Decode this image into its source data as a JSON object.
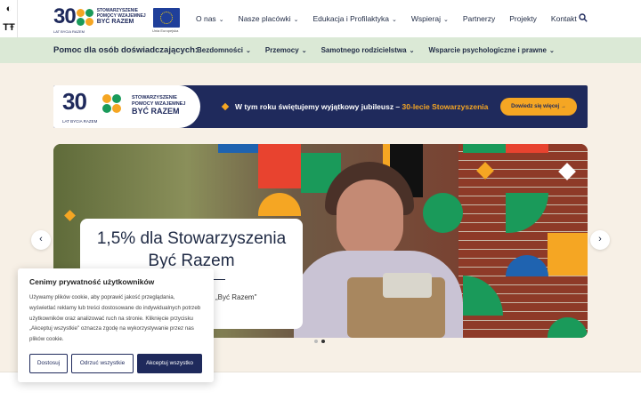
{
  "accessibility": {
    "contrast_icon": "contrast-icon",
    "text_size_label": "TŦ"
  },
  "logo": {
    "number": "30",
    "line1": "STOWARZYSZENIE",
    "line2": "POMOCY WZAJEMNEJ",
    "line3": "BYĆ RAZEM",
    "sub": "LAT BYCIA RAZEM"
  },
  "eu": {
    "label": "Unia Europejska"
  },
  "nav": {
    "items": [
      {
        "label": "O nas",
        "has_dropdown": true
      },
      {
        "label": "Nasze placówki",
        "has_dropdown": true
      },
      {
        "label": "Edukacja i Profilaktyka",
        "has_dropdown": true
      },
      {
        "label": "Wspieraj",
        "has_dropdown": true
      },
      {
        "label": "Partnerzy",
        "has_dropdown": false
      },
      {
        "label": "Projekty",
        "has_dropdown": false
      },
      {
        "label": "Kontakt",
        "has_dropdown": false
      }
    ],
    "search_icon": "search-icon"
  },
  "subnav": {
    "title": "Pomoc dla osób doświadczających:",
    "items": [
      {
        "label": "Bezdomności"
      },
      {
        "label": "Przemocy"
      },
      {
        "label": "Samotnego rodzicielstwa"
      },
      {
        "label": "Wsparcie psychologiczne i prawne"
      }
    ]
  },
  "banner": {
    "logo_number": "30",
    "logo_line1": "STOWARZYSZENIE",
    "logo_line2": "POMOCY WZAJEMNEJ",
    "logo_line3": "BYĆ RAZEM",
    "logo_sub": "LAT BYCIA RAZEM",
    "message": "W tym roku świętujemy wyjątkowy jubileusz – ",
    "highlight": "30-lecie Stowarzyszenia",
    "button": "Dowiedz się więcej →"
  },
  "slider": {
    "title_line1": "1,5% dla Stowarzyszenia",
    "title_line2": "Być Razem",
    "subtitle": "„Być Razem\"",
    "prev_icon": "‹",
    "next_icon": "›",
    "active_slide": 2,
    "slide_count": 2
  },
  "cookie": {
    "title": "Cenimy prywatność użytkowników",
    "text": "Używamy plików cookie, aby poprawić jakość przeglądania, wyświetlać reklamy lub treści dostosowane do indywidualnych potrzeb użytkowników oraz analizować ruch na stronie. Kliknięcie przycisku „Akceptuj wszystkie\" oznacza zgodę na wykorzystywanie przez nas plików cookie.",
    "buttons": {
      "customize": "Dostosuj",
      "reject": "Odrzuć wszystkie",
      "accept": "Akceptuj wszystko"
    }
  },
  "colors": {
    "navy": "#1f2a5c",
    "orange": "#f5a623",
    "green": "#1a9a5a",
    "light_green": "#dbe9d6",
    "cream": "#f7f0e6"
  }
}
